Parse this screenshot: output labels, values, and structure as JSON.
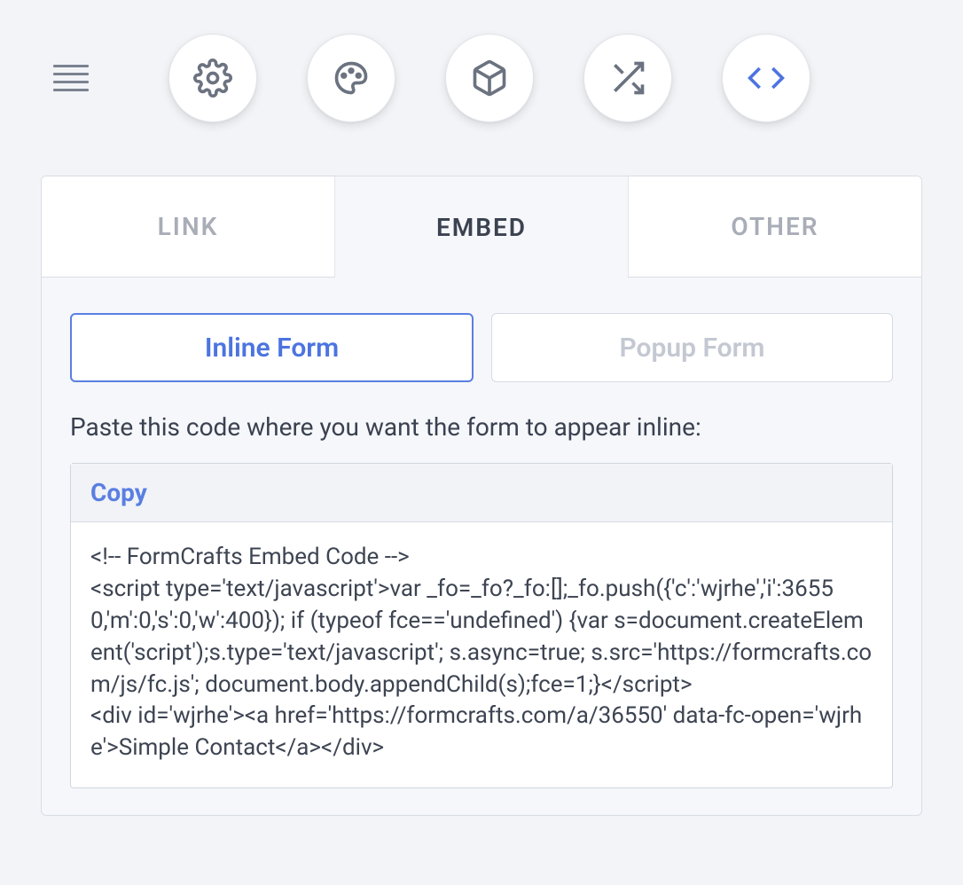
{
  "tabs": {
    "link": "LINK",
    "embed": "EMBED",
    "other": "OTHER"
  },
  "formTypes": {
    "inline": "Inline Form",
    "popup": "Popup Form"
  },
  "instruction": "Paste this code where you want the form to appear inline:",
  "copy": "Copy",
  "embedCode": "<!-- FormCrafts Embed Code -->\n<script type='text/javascript'>var _fo=_fo?_fo:[];_fo.push({'c':'wjrhe','i':36550,'m':0,'s':0,'w':400}); if (typeof fce=='undefined') {var s=document.createElement('script');s.type='text/javascript'; s.async=true; s.src='https://formcrafts.com/js/fc.js'; document.body.appendChild(s);fce=1;}</script>\n<div id='wjrhe'><a href='https://formcrafts.com/a/36550' data-fc-open='wjrhe'>Simple Contact</a></div>"
}
